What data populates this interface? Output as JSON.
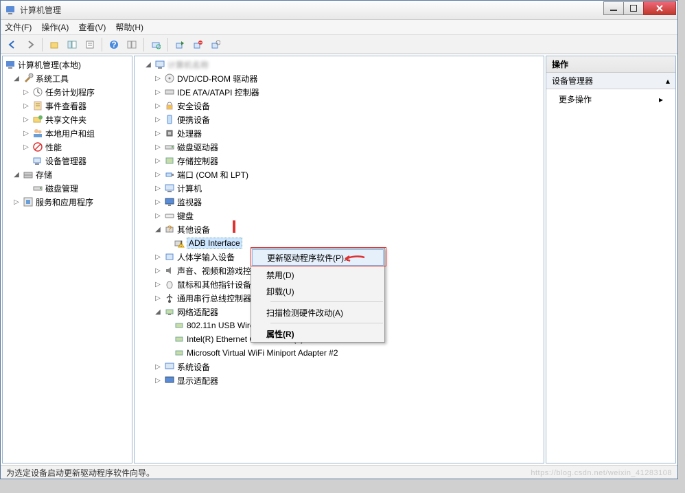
{
  "window": {
    "title": "计算机管理"
  },
  "menu": {
    "file": "文件(F)",
    "action": "操作(A)",
    "view": "查看(V)",
    "help": "帮助(H)"
  },
  "leftTree": {
    "root": "计算机管理(本地)",
    "sysTools": "系统工具",
    "taskSched": "任务计划程序",
    "eventViewer": "事件查看器",
    "sharedFolders": "共享文件夹",
    "localUsers": "本地用户和组",
    "perf": "性能",
    "devMgr": "设备管理器",
    "storage": "存储",
    "diskMgmt": "磁盘管理",
    "services": "服务和应用程序"
  },
  "midTree": {
    "root": "计算机名称",
    "dvd": "DVD/CD-ROM 驱动器",
    "ide": "IDE ATA/ATAPI 控制器",
    "security": "安全设备",
    "portable": "便携设备",
    "cpu": "处理器",
    "diskDrives": "磁盘驱动器",
    "storageCtrl": "存储控制器",
    "ports": "端口 (COM 和 LPT)",
    "computer": "计算机",
    "monitor": "监视器",
    "keyboard": "键盘",
    "other": "其他设备",
    "adb": "ADB Interface",
    "hid": "人体学输入设备",
    "sound": "声音、视频和游戏控制器",
    "mouse": "鼠标和其他指针设备",
    "usb": "通用串行总线控制器",
    "network": "网络适配器",
    "net1": "802.11n USB Wireless LAN Card",
    "net2": "Intel(R) Ethernet Connection (2) I218-LM",
    "net3": "Microsoft Virtual WiFi Miniport Adapter #2",
    "sysDev": "系统设备",
    "display": "显示适配器"
  },
  "right": {
    "header": "操作",
    "sub": "设备管理器",
    "more": "更多操作"
  },
  "ctx": {
    "update": "更新驱动程序软件(P)...",
    "disable": "禁用(D)",
    "uninstall": "卸载(U)",
    "scan": "扫描检测硬件改动(A)",
    "props": "属性(R)"
  },
  "status": "为选定设备启动更新驱动程序软件向导。",
  "watermark": "https://blog.csdn.net/weixin_41283108"
}
